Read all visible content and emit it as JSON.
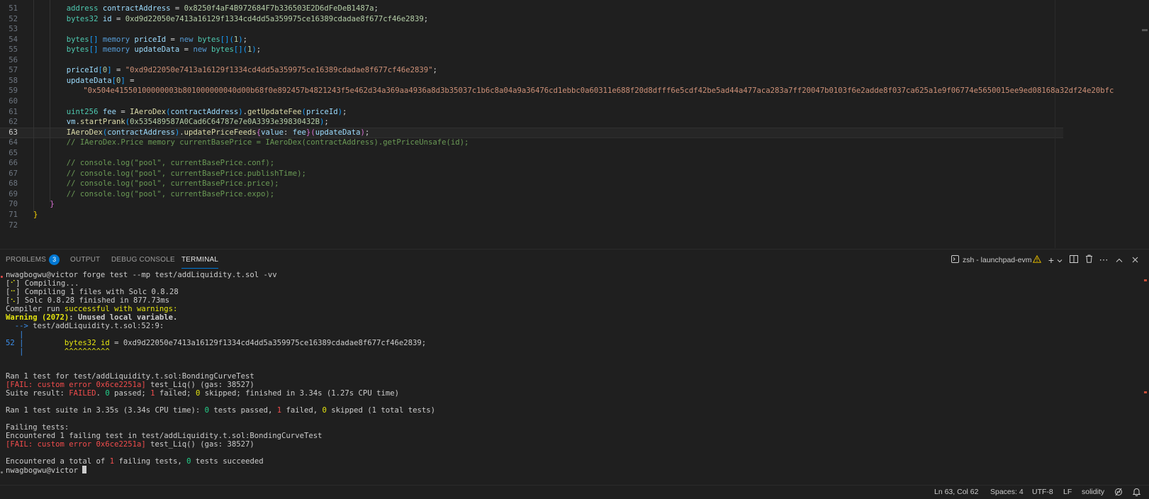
{
  "editor": {
    "lines": [
      {
        "n": "51",
        "indent": 2,
        "tokens": [
          [
            "ty",
            "address"
          ],
          [
            "plain",
            " "
          ],
          [
            "var",
            "contractAddress"
          ],
          [
            "plain",
            " = "
          ],
          [
            "num",
            "0x8250f4aF4B972684F7b336503E2D6dFeDeB1487a"
          ],
          [
            "plain",
            ";"
          ]
        ]
      },
      {
        "n": "52",
        "indent": 2,
        "tokens": [
          [
            "ty",
            "bytes32"
          ],
          [
            "plain",
            " "
          ],
          [
            "var",
            "id"
          ],
          [
            "plain",
            " = "
          ],
          [
            "num",
            "0xd9d22050e7413a16129f1334cd4dd5a359975ce16389cdadae8f677cf46e2839"
          ],
          [
            "plain",
            ";"
          ]
        ]
      },
      {
        "n": "53",
        "indent": 0,
        "tokens": []
      },
      {
        "n": "54",
        "indent": 2,
        "tokens": [
          [
            "ty",
            "bytes"
          ],
          [
            "br2",
            "[]"
          ],
          [
            "plain",
            " "
          ],
          [
            "kw",
            "memory"
          ],
          [
            "plain",
            " "
          ],
          [
            "var",
            "priceId"
          ],
          [
            "plain",
            " = "
          ],
          [
            "kw",
            "new"
          ],
          [
            "plain",
            " "
          ],
          [
            "ty",
            "bytes"
          ],
          [
            "br2",
            "[]"
          ],
          [
            "br2",
            "("
          ],
          [
            "num",
            "1"
          ],
          [
            "br2",
            ")"
          ],
          [
            "plain",
            ";"
          ]
        ]
      },
      {
        "n": "55",
        "indent": 2,
        "tokens": [
          [
            "ty",
            "bytes"
          ],
          [
            "br2",
            "[]"
          ],
          [
            "plain",
            " "
          ],
          [
            "kw",
            "memory"
          ],
          [
            "plain",
            " "
          ],
          [
            "var",
            "updateData"
          ],
          [
            "plain",
            " = "
          ],
          [
            "kw",
            "new"
          ],
          [
            "plain",
            " "
          ],
          [
            "ty",
            "bytes"
          ],
          [
            "br2",
            "[]"
          ],
          [
            "br2",
            "("
          ],
          [
            "num",
            "1"
          ],
          [
            "br2",
            ")"
          ],
          [
            "plain",
            ";"
          ]
        ]
      },
      {
        "n": "56",
        "indent": 0,
        "tokens": []
      },
      {
        "n": "57",
        "indent": 2,
        "tokens": [
          [
            "var",
            "priceId"
          ],
          [
            "br2",
            "["
          ],
          [
            "num",
            "0"
          ],
          [
            "br2",
            "]"
          ],
          [
            "plain",
            " = "
          ],
          [
            "str",
            "\"0xd9d22050e7413a16129f1334cd4dd5a359975ce16389cdadae8f677cf46e2839\""
          ],
          [
            "plain",
            ";"
          ]
        ]
      },
      {
        "n": "58",
        "indent": 2,
        "tokens": [
          [
            "var",
            "updateData"
          ],
          [
            "br2",
            "["
          ],
          [
            "num",
            "0"
          ],
          [
            "br2",
            "]"
          ],
          [
            "plain",
            " ="
          ]
        ]
      },
      {
        "n": "59",
        "indent": 3,
        "tokens": [
          [
            "str",
            "\"0x504e41550100000003b801000000040d00b68f0e892457b4821243f5e462d34a369aa4936a8d3b35037c1b6c8a04a9a36476cd1ebbc0a60311e688f20d8dfff6e5cdf42be5ad44a477aca283a7ff20047b0103f6e2adde8f037ca625a1e9f06774e5650015ee9ed08168a32df24e20bfc"
          ]
        ]
      },
      {
        "n": "60",
        "indent": 0,
        "tokens": []
      },
      {
        "n": "61",
        "indent": 2,
        "tokens": [
          [
            "ty",
            "uint256"
          ],
          [
            "plain",
            " "
          ],
          [
            "var",
            "fee"
          ],
          [
            "plain",
            " = "
          ],
          [
            "fn",
            "IAeroDex"
          ],
          [
            "br2",
            "("
          ],
          [
            "var",
            "contractAddress"
          ],
          [
            "br2",
            ")"
          ],
          [
            "plain",
            "."
          ],
          [
            "fn",
            "getUpdateFee"
          ],
          [
            "br2",
            "("
          ],
          [
            "var",
            "priceId"
          ],
          [
            "br2",
            ")"
          ],
          [
            "plain",
            ";"
          ]
        ]
      },
      {
        "n": "62",
        "indent": 2,
        "tokens": [
          [
            "var",
            "vm"
          ],
          [
            "plain",
            "."
          ],
          [
            "fn",
            "startPrank"
          ],
          [
            "br2",
            "("
          ],
          [
            "num",
            "0x535489587A0Cad6C64787e7e0A3393e39830432B"
          ],
          [
            "br2",
            ")"
          ],
          [
            "plain",
            ";"
          ]
        ]
      },
      {
        "n": "63",
        "indent": 2,
        "current": true,
        "tokens": [
          [
            "fn",
            "IAeroDex"
          ],
          [
            "br2",
            "("
          ],
          [
            "var",
            "contractAddress"
          ],
          [
            "br2",
            ")"
          ],
          [
            "plain",
            "."
          ],
          [
            "fn",
            "updatePriceFeeds"
          ],
          [
            "br",
            "{"
          ],
          [
            "var",
            "value"
          ],
          [
            "plain",
            ": "
          ],
          [
            "var",
            "fee"
          ],
          [
            "br",
            "}"
          ],
          [
            "br",
            "("
          ],
          [
            "var",
            "updateData"
          ],
          [
            "br",
            ")"
          ],
          [
            "plain",
            ";"
          ]
        ]
      },
      {
        "n": "64",
        "indent": 2,
        "tokens": [
          [
            "com",
            "// IAeroDex.Price memory currentBasePrice = IAeroDex(contractAddress).getPriceUnsafe(id);"
          ]
        ]
      },
      {
        "n": "65",
        "indent": 0,
        "tokens": []
      },
      {
        "n": "66",
        "indent": 2,
        "tokens": [
          [
            "com",
            "// console.log(\"pool\", currentBasePrice.conf);"
          ]
        ]
      },
      {
        "n": "67",
        "indent": 2,
        "tokens": [
          [
            "com",
            "// console.log(\"pool\", currentBasePrice.publishTime);"
          ]
        ]
      },
      {
        "n": "68",
        "indent": 2,
        "tokens": [
          [
            "com",
            "// console.log(\"pool\", currentBasePrice.price);"
          ]
        ]
      },
      {
        "n": "69",
        "indent": 2,
        "tokens": [
          [
            "com",
            "// console.log(\"pool\", currentBasePrice.expo);"
          ]
        ]
      },
      {
        "n": "70",
        "indent": 1,
        "tokens": [
          [
            "br",
            "}"
          ]
        ]
      },
      {
        "n": "71",
        "indent": 0,
        "tokens": [
          [
            "br3",
            "}"
          ]
        ]
      },
      {
        "n": "72",
        "indent": 0,
        "tokens": []
      }
    ]
  },
  "panel": {
    "tabs": [
      {
        "key": "problems",
        "label": "PROBLEMS",
        "badge": "3"
      },
      {
        "key": "output",
        "label": "OUTPUT"
      },
      {
        "key": "debug",
        "label": "DEBUG CONSOLE"
      },
      {
        "key": "terminal",
        "label": "TERMINAL",
        "active": true
      }
    ],
    "terminal_name": "zsh - launchpad-evm",
    "icons": [
      "terminal-icon",
      "warning-icon",
      "plus-icon",
      "chevron-down-icon",
      "split-icon",
      "trash-icon",
      "more-icon",
      "maximize-icon",
      "close-icon"
    ]
  },
  "terminal": {
    "lines": [
      [
        [
          "",
          "nwagbogwu@victor forge test --mp test/addLiquidity.t.sol -vv"
        ]
      ],
      [
        [
          "",
          "["
        ],
        [
          "yellow",
          "⠊"
        ],
        [
          "",
          "] Compiling..."
        ]
      ],
      [
        [
          "",
          "["
        ],
        [
          "yellow",
          "⠒"
        ],
        [
          "",
          "] Compiling 1 files with Solc 0.8.28"
        ]
      ],
      [
        [
          "",
          "["
        ],
        [
          "yellow",
          "⠢"
        ],
        [
          "",
          "] Solc 0.8.28 finished in 877.73ms"
        ]
      ],
      [
        [
          "",
          "Compiler run "
        ],
        [
          "yellow",
          "successful with warnings:"
        ]
      ],
      [
        [
          "yellowb",
          "Warning (2072)"
        ],
        [
          "bold",
          ": Unused local variable."
        ]
      ],
      [
        [
          "blue",
          "  --> "
        ],
        [
          "",
          "test/addLiquidity.t.sol:52:9:"
        ]
      ],
      [
        [
          "blue",
          "   |"
        ]
      ],
      [
        [
          "blue",
          "52 |"
        ],
        [
          "",
          "         "
        ],
        [
          "yellow",
          "bytes32 id"
        ],
        [
          "",
          " = 0xd9d22050e7413a16129f1334cd4dd5a359975ce16389cdadae8f677cf46e2839;"
        ]
      ],
      [
        [
          "blue",
          "   |"
        ],
        [
          "",
          "         "
        ],
        [
          "yellow",
          "^^^^^^^^^^"
        ]
      ],
      [],
      [],
      [
        [
          "",
          "Ran 1 test for test/addLiquidity.t.sol:BondingCurveTest"
        ]
      ],
      [
        [
          "red",
          "[FAIL: custom error 0x6ce2251a]"
        ],
        [
          "",
          " test_Liq() (gas: 38527)"
        ]
      ],
      [
        [
          "",
          "Suite result: "
        ],
        [
          "red",
          "FAILED"
        ],
        [
          "",
          ". "
        ],
        [
          "green",
          "0"
        ],
        [
          "",
          " passed; "
        ],
        [
          "red",
          "1"
        ],
        [
          "",
          " failed; "
        ],
        [
          "yellow",
          "0"
        ],
        [
          "",
          " skipped; finished in 3.34s (1.27s CPU time)"
        ]
      ],
      [],
      [
        [
          "",
          "Ran 1 test suite in 3.35s (3.34s CPU time): "
        ],
        [
          "green",
          "0"
        ],
        [
          "",
          " tests passed, "
        ],
        [
          "red",
          "1"
        ],
        [
          "",
          " failed, "
        ],
        [
          "yellow",
          "0"
        ],
        [
          "",
          " skipped (1 total tests)"
        ]
      ],
      [],
      [
        [
          "",
          "Failing tests:"
        ]
      ],
      [
        [
          "",
          "Encountered 1 failing test in test/addLiquidity.t.sol:BondingCurveTest"
        ]
      ],
      [
        [
          "red",
          "[FAIL: custom error 0x6ce2251a]"
        ],
        [
          "",
          " test_Liq() (gas: 38527)"
        ]
      ],
      [],
      [
        [
          "",
          "Encountered a total of "
        ],
        [
          "red",
          "1"
        ],
        [
          "",
          " failing tests, "
        ],
        [
          "green",
          "0"
        ],
        [
          "",
          " tests succeeded"
        ]
      ],
      [
        [
          "",
          "nwagbogwu@victor "
        ],
        [
          "cursor",
          ""
        ]
      ]
    ]
  },
  "status": {
    "position": "Ln 63, Col 62",
    "spaces": "Spaces: 4",
    "encoding": "UTF-8",
    "eol": "LF",
    "language": "solidity"
  },
  "colors": {
    "accent": "#0078d4",
    "warning": "#cca700",
    "error": "#f14c4c"
  }
}
